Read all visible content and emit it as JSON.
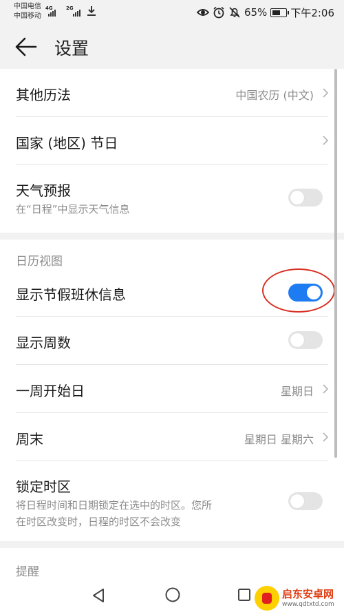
{
  "status_bar": {
    "carrier1": "中国电信",
    "carrier2": "中国移动",
    "net1": "4G",
    "net2": "2G",
    "battery": "65%",
    "battery_level": 0.65,
    "time": "下午2:06",
    "icons": [
      "eye-icon",
      "alarm-icon",
      "mute-icon",
      "download-icon"
    ]
  },
  "header": {
    "title": "设置"
  },
  "section1": {
    "items": [
      {
        "title": "其他历法",
        "value": "中国农历 (中文)"
      },
      {
        "title": "国家 (地区) 节日",
        "value": ""
      },
      {
        "title": "天气预报",
        "subtitle": "在“日程”中显示天气信息",
        "toggle": false
      }
    ]
  },
  "calendar_view": {
    "header": "日历视图",
    "items": [
      {
        "title": "显示节假班休信息",
        "toggle": true
      },
      {
        "title": "显示周数",
        "toggle": false
      },
      {
        "title": "一周开始日",
        "value": "星期日"
      },
      {
        "title": "周末",
        "value": "星期日 星期六"
      },
      {
        "title": "锁定时区",
        "subtitle_line1": "将日程时间和日期锁定在选中的时区。您所",
        "subtitle_line2": "在时区改变时，日程的时区不会改变",
        "toggle": false
      }
    ]
  },
  "reminder": {
    "header": "提醒"
  },
  "watermark": {
    "name": "启东安卓网",
    "url": "www.qdtxtd.com"
  },
  "colors": {
    "accent": "#1e7cf2",
    "annotation": "#d93025",
    "background": "#f2f2f2"
  }
}
